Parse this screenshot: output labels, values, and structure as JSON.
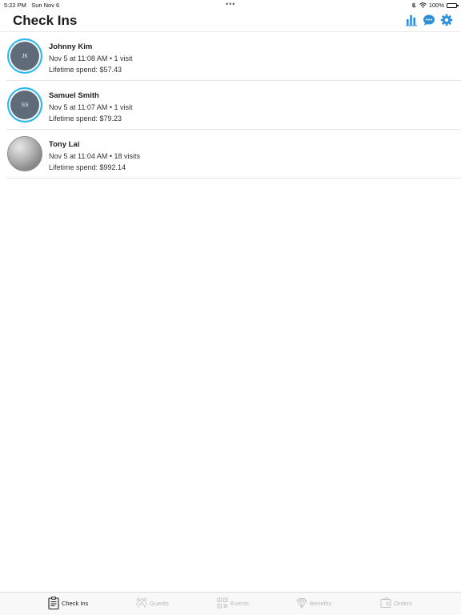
{
  "status_bar": {
    "time": "5:22 PM",
    "date": "Sun Nov 6",
    "battery": "100%"
  },
  "header": {
    "title": "Check Ins"
  },
  "checkins": [
    {
      "initials": "JK",
      "name": "Johnny Kim",
      "checkin": "Nov 5 at 11:08 AM • 1 visit",
      "spend": "Lifetime spend: $57.43"
    },
    {
      "initials": "SS",
      "name": "Samuel Smith",
      "checkin": "Nov 5 at 11:07 AM • 1 visit",
      "spend": "Lifetime spend: $79.23"
    },
    {
      "initials": "",
      "name": "Tony Lai",
      "checkin": "Nov 5 at 11:04 AM • 18 visits",
      "spend": "Lifetime spend: $992.14"
    }
  ],
  "tabs": [
    {
      "label": "Check Ins",
      "icon": "clipboard-icon",
      "active": true
    },
    {
      "label": "Guests",
      "icon": "guests-icon",
      "active": false
    },
    {
      "label": "Events",
      "icon": "qr-code-icon",
      "active": false
    },
    {
      "label": "Benefits",
      "icon": "diamond-icon",
      "active": false
    },
    {
      "label": "Orders",
      "icon": "wallet-icon",
      "active": false
    }
  ],
  "colors": {
    "accent": "#2f8fd8",
    "ring": "#28b8f0",
    "avatar_fill": "#5f6b78"
  }
}
